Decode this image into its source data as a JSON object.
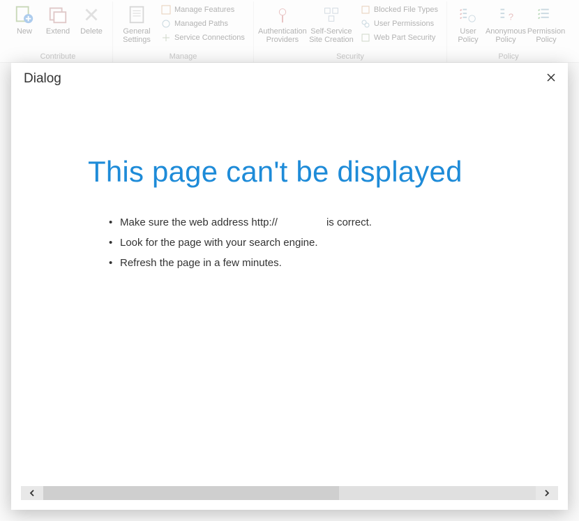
{
  "ribbon": {
    "groups": [
      {
        "label": "Contribute",
        "buttons": [
          {
            "type": "big",
            "name": "new-button",
            "label": "New"
          },
          {
            "type": "big",
            "name": "extend-button",
            "label": "Extend"
          },
          {
            "type": "big",
            "name": "delete-button",
            "label": "Delete"
          }
        ]
      },
      {
        "label": "Manage",
        "buttons": [
          {
            "type": "big",
            "name": "general-settings-button",
            "label": "General Settings"
          },
          {
            "type": "small",
            "name": "manage-features-button",
            "label": "Manage Features"
          },
          {
            "type": "small",
            "name": "managed-paths-button",
            "label": "Managed Paths"
          },
          {
            "type": "small",
            "name": "service-connections-button",
            "label": "Service Connections"
          }
        ]
      },
      {
        "label": "Security",
        "buttons": [
          {
            "type": "big",
            "name": "authentication-providers-button",
            "label": "Authentication Providers"
          },
          {
            "type": "big",
            "name": "self-service-site-button",
            "label": "Self-Service Site Creation"
          },
          {
            "type": "small",
            "name": "blocked-file-types-button",
            "label": "Blocked File Types"
          },
          {
            "type": "small",
            "name": "user-permissions-button",
            "label": "User Permissions"
          },
          {
            "type": "small",
            "name": "web-part-security-button",
            "label": "Web Part Security"
          }
        ]
      },
      {
        "label": "Policy",
        "buttons": [
          {
            "type": "big",
            "name": "user-policy-button",
            "label": "User Policy"
          },
          {
            "type": "big",
            "name": "anonymous-policy-button",
            "label": "Anonymous Policy"
          },
          {
            "type": "big",
            "name": "permission-policy-button",
            "label": "Permission Policy"
          }
        ]
      }
    ]
  },
  "dialog": {
    "title": "Dialog",
    "error": {
      "heading": "This page can't be displayed",
      "items": {
        "b1a": "Make sure the web address http://",
        "b1b": "is correct.",
        "b2": "Look for the page with your search engine.",
        "b3": "Refresh the page in a few minutes."
      }
    }
  }
}
